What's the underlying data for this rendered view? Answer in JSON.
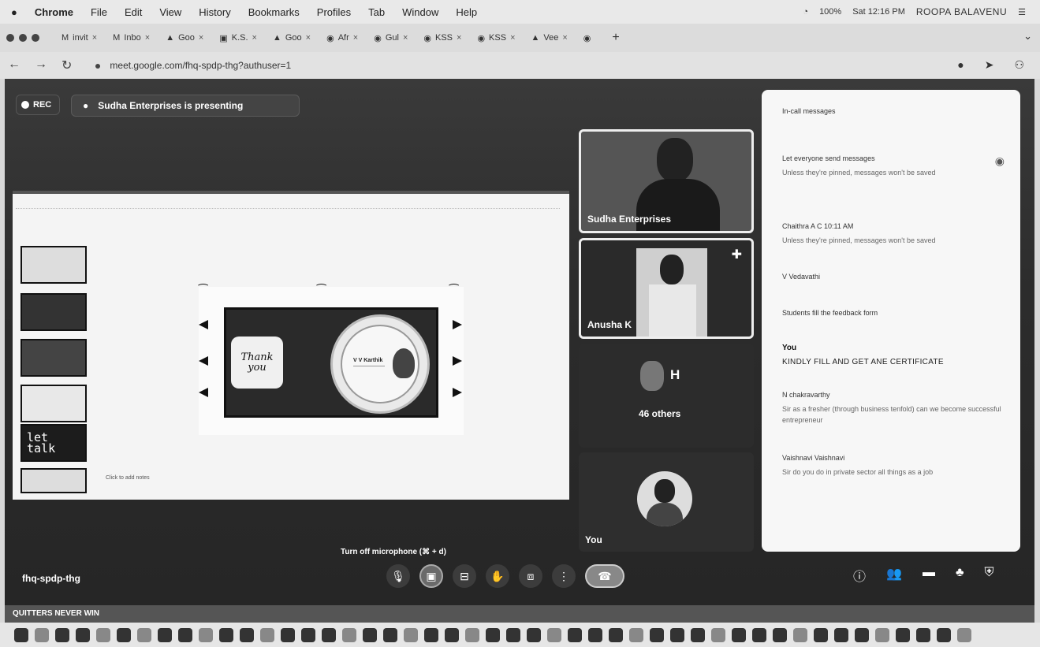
{
  "menubar": {
    "app": "Chrome",
    "items": [
      "File",
      "Edit",
      "View",
      "History",
      "Bookmarks",
      "Profiles",
      "Tab",
      "Window",
      "Help"
    ],
    "battery": "100%",
    "clock": "Sat 12:16 PM",
    "user": "ROOPA BALAVENU"
  },
  "tabs": [
    {
      "icon": "M",
      "label": "invit"
    },
    {
      "icon": "M",
      "label": "Inbo"
    },
    {
      "icon": "▲",
      "label": "Goo"
    },
    {
      "icon": "▣",
      "label": "K.S."
    },
    {
      "icon": "▲",
      "label": "Goo"
    },
    {
      "icon": "◉",
      "label": "Afr"
    },
    {
      "icon": "◉",
      "label": "Gul"
    },
    {
      "icon": "◉",
      "label": "KSS"
    },
    {
      "icon": "◉",
      "label": "KSS"
    },
    {
      "icon": "▲",
      "label": "Vee"
    },
    {
      "icon": "◉",
      "label": ""
    }
  ],
  "address": {
    "url": "meet.google.com/fhq-spdp-thg?authuser=1"
  },
  "meet": {
    "rec_label": "REC",
    "presenting": "Sudha Enterprises is presenting",
    "speaker_notes": "Click to add notes",
    "slide_name": "V V Karthik",
    "thank_you_1": "Thank",
    "thank_you_2": "you",
    "thumb_lets_talk_1": "let",
    "thumb_lets_talk_2": "talk",
    "tiles": [
      {
        "name": "Sudha Enterprises"
      },
      {
        "name": "Anusha K"
      },
      {
        "initial": "H",
        "count": "46 others"
      },
      {
        "name": "You"
      }
    ],
    "tooltip": "Turn off microphone (⌘ + d)",
    "meeting_code": "fhq-spdp-thg"
  },
  "chat": {
    "messages": [
      {
        "sender": "In-call messages",
        "body": ""
      },
      {
        "sender": "Let everyone send messages",
        "body": "Unless they're pinned, messages won't be saved"
      },
      {
        "sender": "Chaithra A C  10:11 AM",
        "body": "Unless they're pinned, messages won't be saved"
      },
      {
        "sender": "V Vedavathi",
        "body": ""
      },
      {
        "sender": "Students fill the feedback form",
        "body": ""
      },
      {
        "sender": "You",
        "body": "KINDLY FILL AND GET ANE CERTIFICATE"
      },
      {
        "sender": "N chakravarthy",
        "body": "Sir as a fresher (through business tenfold) can we become successful entrepreneur"
      },
      {
        "sender": "Vaishnavi Vaishnavi",
        "body": "Sir do you do in private sector all things as a job"
      }
    ]
  },
  "ticker": "QUITTERS NEVER WIN"
}
